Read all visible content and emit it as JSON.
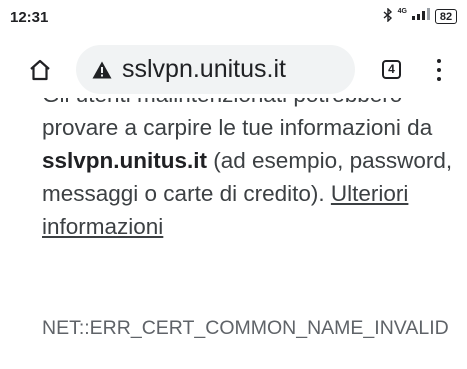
{
  "status_bar": {
    "time": "12:31",
    "network": "4G",
    "battery": "82"
  },
  "toolbar": {
    "url": "sslvpn.unitus.it",
    "tab_count": "4"
  },
  "content": {
    "partial_line": "Gli utenti malintenzionati",
    "text_before_host": "potrebbero provare a carpire le tue informazioni da ",
    "host": "sslvpn.unitus.it",
    "text_after_host": " (ad esempio, password, messaggi o carte di credito). ",
    "learn_more_link": "Ulteriori informazioni",
    "error_code": "NET::ERR_CERT_COMMON_NAME_INVALID"
  },
  "colors": {
    "omnibox_bg": "#f1f3f4",
    "text": "#3c4043",
    "icon": "#202124"
  }
}
